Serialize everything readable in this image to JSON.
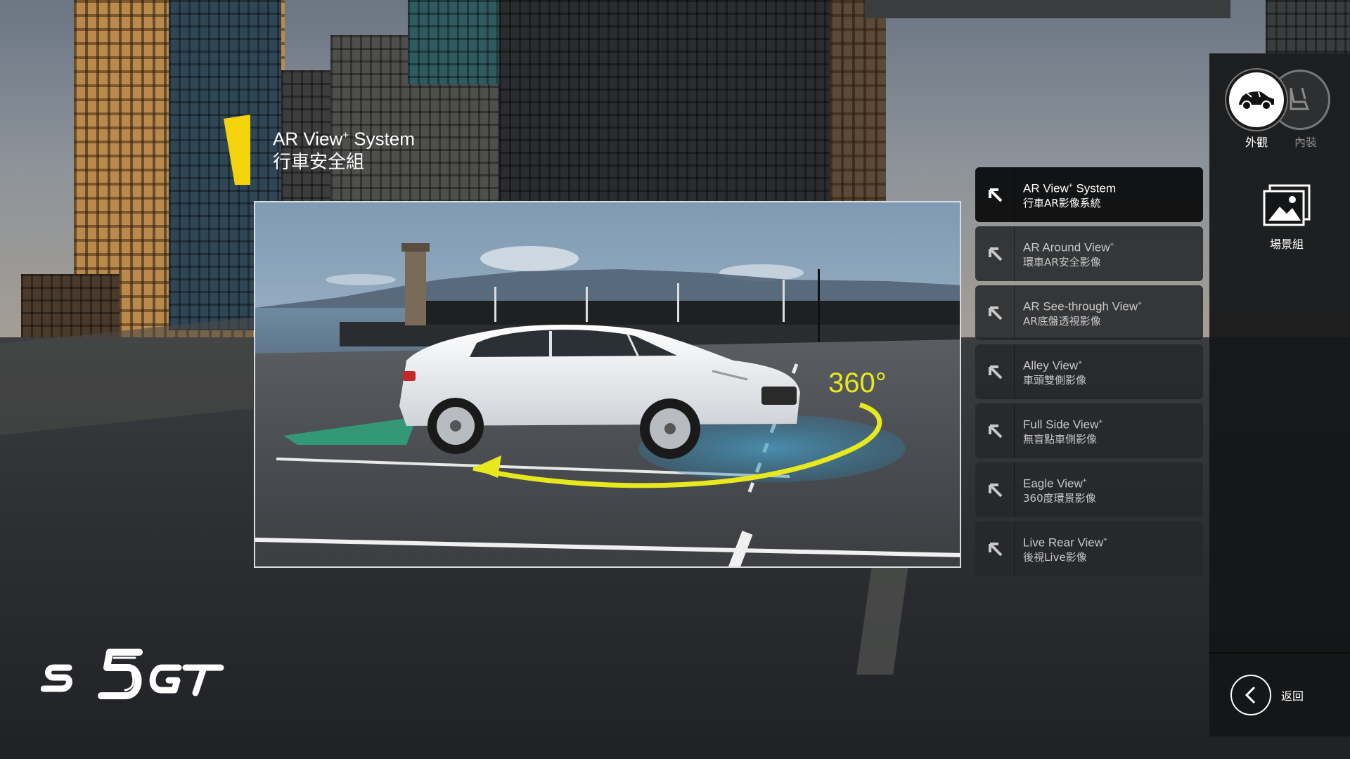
{
  "title": {
    "en_main": "AR View",
    "en_sup": "+",
    "en_tail": " System",
    "zh": "行車安全組"
  },
  "photo": {
    "overlay_label": "360°"
  },
  "features": [
    {
      "en": "AR View",
      "sup": "+",
      "tail": " System",
      "zh": "行車AR影像系統",
      "active": true
    },
    {
      "en": "AR Around View",
      "sup": "+",
      "tail": "",
      "zh": "環車AR安全影像",
      "active": false
    },
    {
      "en": "AR See-through View",
      "sup": "+",
      "tail": "",
      "zh": "AR底盤透視影像",
      "active": false
    },
    {
      "en": "Alley View",
      "sup": "+",
      "tail": "",
      "zh": "車頭雙側影像",
      "active": false
    },
    {
      "en": "Full Side View",
      "sup": "+",
      "tail": "",
      "zh": "無盲點車側影像",
      "active": false
    },
    {
      "en": "Eagle View",
      "sup": "+",
      "tail": "",
      "zh": "360度環景影像",
      "active": false
    },
    {
      "en": "Live Rear View",
      "sup": "+",
      "tail": "",
      "zh": "後視Live影像",
      "active": false
    }
  ],
  "sidebar": {
    "exterior_label": "外觀",
    "interior_label": "內裝",
    "scene_label": "場景組",
    "back_label": "返回"
  },
  "icons": {
    "feature_arrow": "arrow-up-left-icon",
    "exterior": "car-icon",
    "interior": "seat-icon",
    "scene": "image-gallery-icon",
    "back": "chevron-left-icon"
  },
  "colors": {
    "accent_yellow": "#f4d20c",
    "ring_yellow": "#e8e81e",
    "zone_green": "#2fa57b",
    "zone_blue": "#3f8fb5"
  },
  "logo": {
    "brand_text": "s5GT"
  }
}
